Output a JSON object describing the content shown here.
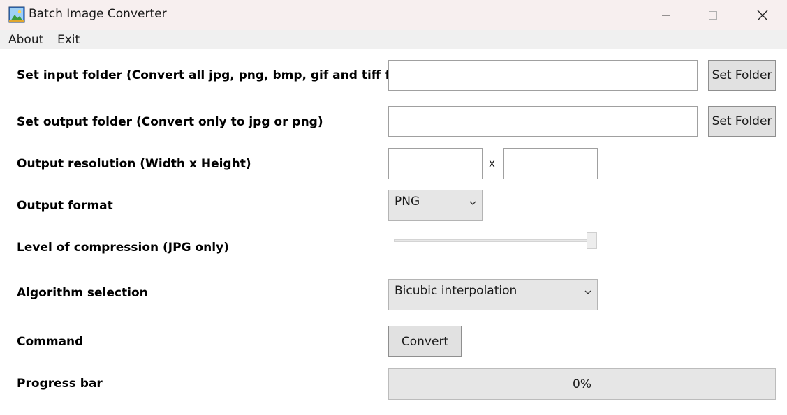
{
  "window": {
    "title": "Batch Image Converter",
    "icon": "landscape-image-icon"
  },
  "menu": {
    "items": [
      {
        "label": "About"
      },
      {
        "label": "Exit"
      }
    ]
  },
  "form": {
    "input_folder": {
      "label": "Set input folder (Convert all jpg, png, bmp, gif and tiff files)",
      "value": "",
      "button": "Set Folder"
    },
    "output_folder": {
      "label": "Set output folder (Convert only to jpg or png)",
      "value": "",
      "button": "Set Folder"
    },
    "resolution": {
      "label": "Output resolution (Width x Height)",
      "width": "",
      "separator": "x",
      "height": ""
    },
    "format": {
      "label": "Output format",
      "selected": "PNG"
    },
    "compression": {
      "label": "Level of compression (JPG only)",
      "slider_level": 1.0
    },
    "algorithm": {
      "label": "Algorithm selection",
      "selected": "Bicubic interpolation"
    },
    "command": {
      "label": "Command",
      "button": "Convert"
    },
    "progress": {
      "label": "Progress bar",
      "value": 0,
      "text": "0%"
    }
  },
  "colors": {
    "titlebar": "#f7efef",
    "menubar": "#f0f0f0",
    "button_face": "#e1e1e1",
    "progress_fill": "#06b025"
  }
}
